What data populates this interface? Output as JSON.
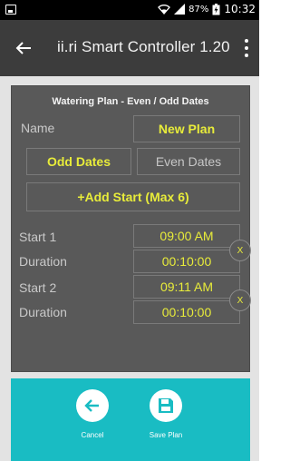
{
  "status_bar": {
    "battery_percent": "87%",
    "time": "10:32",
    "icons": [
      "notification-image-icon",
      "wifi-icon",
      "signal-icon",
      "battery-icon"
    ]
  },
  "app_bar": {
    "title": "ii.ri Smart Controller 1.20",
    "icons": [
      "back-arrow-icon",
      "overflow-menu-icon"
    ]
  },
  "plan": {
    "title": "Watering Plan - Even / Odd Dates",
    "name_label": "Name",
    "name_value": "New Plan",
    "odd_label": "Odd Dates",
    "even_label": "Even Dates",
    "selected_mode": "Odd Dates",
    "add_start_label": "+Add Start (Max 6)",
    "starts": [
      {
        "start_label": "Start 1",
        "start_time": "09:00 AM",
        "duration_label": "Duration",
        "duration_value": "00:10:00",
        "remove_label": "X"
      },
      {
        "start_label": "Start 2",
        "start_time": "09:11 AM",
        "duration_label": "Duration",
        "duration_value": "00:10:00",
        "remove_label": "X"
      }
    ]
  },
  "actions": {
    "cancel_label": "Cancel",
    "save_label": "Save Plan",
    "icons": [
      "back-arrow-icon",
      "save-disk-icon"
    ]
  },
  "colors": {
    "accent_yellow": "#e8ec3a",
    "teal": "#19bcc3",
    "panel_grey": "#595959",
    "app_bar": "#3c3c3c"
  }
}
